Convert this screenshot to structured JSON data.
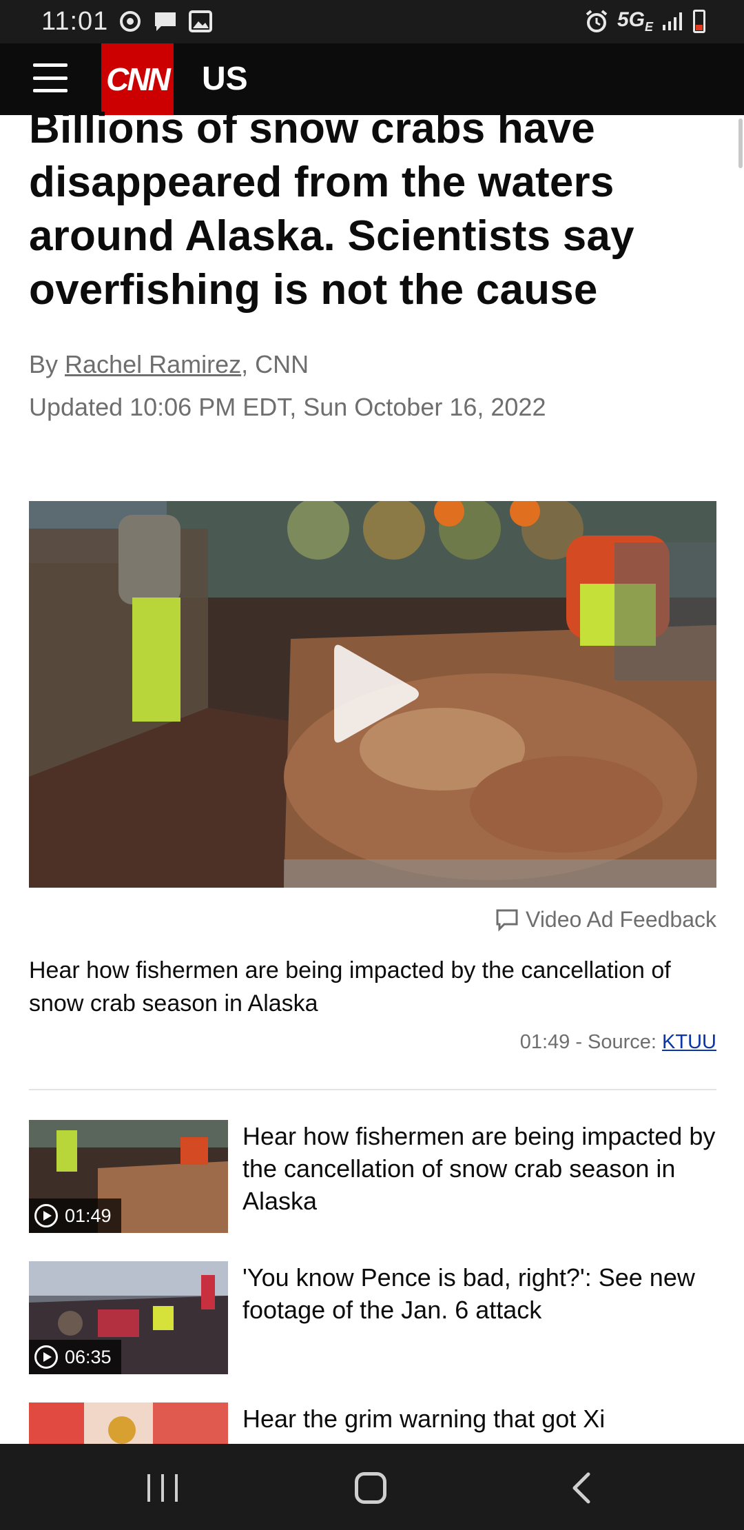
{
  "status_bar": {
    "time": "11:01",
    "network": "5G",
    "network_sub": "E",
    "icons": [
      "sync-icon",
      "message-icon",
      "image-icon",
      "alarm-icon",
      "signal-icon",
      "battery-icon"
    ]
  },
  "header": {
    "logo": "CNN",
    "section": "US",
    "brand_color": "#cc0000"
  },
  "article": {
    "headline": "Billions of snow crabs have disappeared from the waters around Alaska. Scientists say overfishing is not the cause",
    "byline_prefix": "By",
    "author": "Rachel Ramirez",
    "byline_suffix": ", CNN",
    "updated": "Updated 10:06 PM EDT, Sun October 16, 2022"
  },
  "video": {
    "ad_feedback": "Video Ad Feedback",
    "caption": "Hear how fishermen are being impacted by the cancellation of snow crab season in Alaska",
    "meta_prefix": "01:49 - Source: ",
    "source": "KTUU"
  },
  "related_videos": [
    {
      "title": "Hear how fishermen are being impacted by the cancellation of snow crab season in Alaska",
      "duration": "01:49"
    },
    {
      "title": "'You know Pence is bad, right?': See new footage of the Jan. 6 attack",
      "duration": "06:35"
    },
    {
      "title": "Hear the grim warning that got Xi",
      "duration": ""
    }
  ],
  "nav": {
    "buttons": [
      "recent-apps",
      "home",
      "back"
    ]
  }
}
